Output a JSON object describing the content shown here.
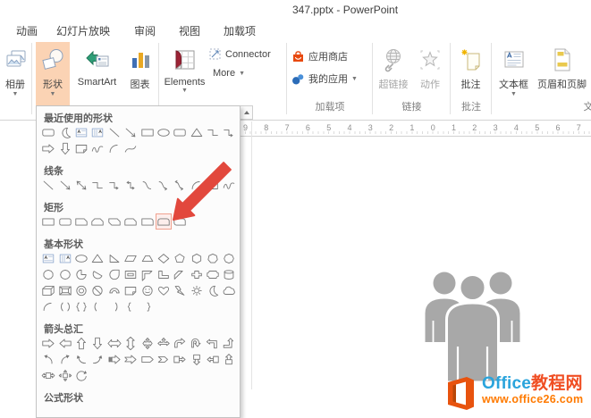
{
  "window": {
    "title": "347.pptx - PowerPoint"
  },
  "tabs": [
    "动画",
    "幻灯片放映",
    "审阅",
    "视图",
    "加载项"
  ],
  "ribbon": {
    "album": "相册",
    "shapes": "形状",
    "smartart": "SmartArt",
    "chart": "图表",
    "elements": "Elements",
    "connector": "Connector",
    "more": "More",
    "app_store": "应用商店",
    "my_apps": "我的应用",
    "hyperlink": "超链接",
    "action": "动作",
    "comment": "批注",
    "textbox": "文本框",
    "header_footer": "页眉和页脚",
    "group_addins": "加载项",
    "group_links": "链接",
    "group_comments": "批注",
    "group_text_partial": "文"
  },
  "ruler": {
    "numbers": [
      "9",
      "8",
      "7",
      "6",
      "5",
      "4",
      "3",
      "2",
      "1",
      "0",
      "1",
      "2",
      "3",
      "4",
      "5",
      "6",
      "7"
    ]
  },
  "shapes_menu": {
    "sections": [
      {
        "title": "最近使用的形状",
        "rows": [
          [
            {
              "n": "rounded-rectangle"
            },
            {
              "n": "moon"
            },
            {
              "n": "text-box"
            },
            {
              "n": "vertical-text-box"
            },
            {
              "n": "line"
            },
            {
              "n": "line-arrow"
            },
            {
              "n": "rectangle"
            },
            {
              "n": "oval"
            },
            {
              "n": "rounded-rectangle"
            },
            {
              "n": "isosceles-triangle"
            },
            {
              "n": "elbow-connector"
            },
            {
              "n": "elbow-arrow-connector"
            }
          ],
          [
            {
              "n": "right-arrow"
            },
            {
              "n": "down-arrow"
            },
            {
              "n": "folded-corner"
            },
            {
              "n": "scribble"
            },
            {
              "n": "arc"
            },
            {
              "n": "curve"
            }
          ]
        ]
      },
      {
        "title": "线条",
        "rows": [
          [
            {
              "n": "line"
            },
            {
              "n": "line-arrow"
            },
            {
              "n": "line-double-arrow"
            },
            {
              "n": "elbow-connector"
            },
            {
              "n": "elbow-arrow-connector"
            },
            {
              "n": "elbow-double-arrow-connector"
            },
            {
              "n": "curved-connector"
            },
            {
              "n": "curved-arrow-connector"
            },
            {
              "n": "curved-double-arrow-connector"
            },
            {
              "n": "arc"
            },
            {
              "n": "freeform"
            },
            {
              "n": "scribble"
            }
          ]
        ]
      },
      {
        "title": "矩形",
        "rows": [
          [
            {
              "n": "rectangle"
            },
            {
              "n": "rounded-rectangle"
            },
            {
              "n": "snip-single-corner-rectangle"
            },
            {
              "n": "snip-same-side-corner-rectangle"
            },
            {
              "n": "snip-diagonal-corner-rectangle"
            },
            {
              "n": "snip-round-single-corner-rectangle"
            },
            {
              "n": "round-single-corner-rectangle"
            },
            {
              "n": "round-same-side-corner-rectangle",
              "hl": true
            },
            {
              "n": "round-diagonal-corner-rectangle"
            }
          ]
        ]
      },
      {
        "title": "基本形状",
        "rows": [
          [
            {
              "n": "text-box"
            },
            {
              "n": "vertical-text-box"
            },
            {
              "n": "oval"
            },
            {
              "n": "isosceles-triangle"
            },
            {
              "n": "right-triangle"
            },
            {
              "n": "parallelogram"
            },
            {
              "n": "trapezoid"
            },
            {
              "n": "diamond"
            },
            {
              "n": "pentagon"
            },
            {
              "n": "hexagon"
            },
            {
              "n": "heptagon"
            },
            {
              "n": "octagon"
            }
          ],
          [
            {
              "n": "decagon"
            },
            {
              "n": "dodecagon"
            },
            {
              "n": "pie"
            },
            {
              "n": "chord"
            },
            {
              "n": "teardrop"
            },
            {
              "n": "frame"
            },
            {
              "n": "half-frame"
            },
            {
              "n": "l-shape"
            },
            {
              "n": "diagonal-stripe"
            },
            {
              "n": "cross"
            },
            {
              "n": "plaque"
            },
            {
              "n": "can"
            }
          ],
          [
            {
              "n": "cube"
            },
            {
              "n": "bevel"
            },
            {
              "n": "donut"
            },
            {
              "n": "no-symbol"
            },
            {
              "n": "block-arc"
            },
            {
              "n": "folded-corner"
            },
            {
              "n": "smiley-face"
            },
            {
              "n": "heart"
            },
            {
              "n": "lightning-bolt"
            },
            {
              "n": "sun"
            },
            {
              "n": "moon"
            },
            {
              "n": "cloud"
            }
          ],
          [
            {
              "n": "arc"
            },
            {
              "n": "double-bracket"
            },
            {
              "n": "double-brace"
            },
            {
              "n": "left-bracket"
            },
            {
              "n": "right-bracket"
            },
            {
              "n": "left-brace"
            },
            {
              "n": "right-brace"
            }
          ]
        ]
      },
      {
        "title": "箭头总汇",
        "rows": [
          [
            {
              "n": "right-arrow"
            },
            {
              "n": "left-arrow"
            },
            {
              "n": "up-arrow"
            },
            {
              "n": "down-arrow"
            },
            {
              "n": "left-right-arrow"
            },
            {
              "n": "up-down-arrow"
            },
            {
              "n": "quad-arrow"
            },
            {
              "n": "left-right-up-arrow"
            },
            {
              "n": "bent-arrow"
            },
            {
              "n": "u-turn-arrow"
            },
            {
              "n": "left-up-arrow"
            },
            {
              "n": "bent-up-arrow"
            }
          ],
          [
            {
              "n": "curved-left-arrow"
            },
            {
              "n": "curved-right-arrow"
            },
            {
              "n": "curved-up-arrow"
            },
            {
              "n": "curved-down-arrow"
            },
            {
              "n": "striped-right-arrow"
            },
            {
              "n": "notched-right-arrow"
            },
            {
              "n": "pentagon-arrow"
            },
            {
              "n": "chevron-arrow"
            },
            {
              "n": "right-arrow-callout"
            },
            {
              "n": "down-arrow-callout"
            },
            {
              "n": "left-arrow-callout"
            },
            {
              "n": "up-arrow-callout"
            }
          ],
          [
            {
              "n": "left-right-arrow-callout"
            },
            {
              "n": "quad-arrow-callout"
            },
            {
              "n": "circular-arrow"
            }
          ]
        ]
      },
      {
        "title": "公式形状",
        "rows": []
      }
    ]
  },
  "watermark": {
    "brand_blue": "Office",
    "brand_orange": "教程网",
    "url": "www.office26.com"
  },
  "colors": {
    "active_button_peach": "#fbd3b4",
    "annotation_arrow_red": "#e2483d",
    "figure_gray": "#a8a8a8",
    "brand_blue": "#2aa4dc",
    "brand_orange": "#f04e23",
    "url_orange": "#ff7a00",
    "highlight_cell_border": "#f0a28f"
  }
}
